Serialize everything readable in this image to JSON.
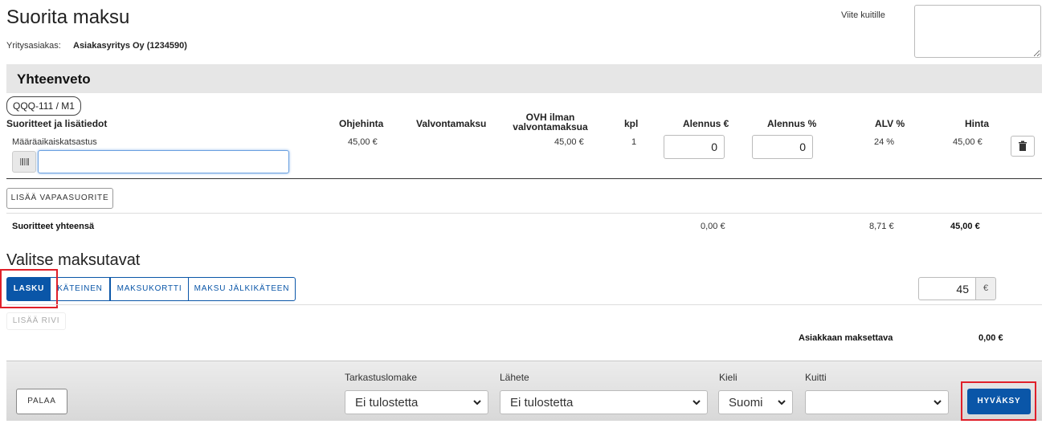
{
  "page": {
    "title": "Suorita maksu",
    "customer_label": "Yritysasiakas:",
    "customer_value": "Asiakasyritys Oy (1234590)",
    "reference_label": "Viite kuitille",
    "reference_value": ""
  },
  "summary": {
    "heading": "Yhteenveto",
    "vehicle_tag": "QQQ-111 / M1",
    "columns": {
      "service": "Suoritteet ja lisätiedot",
      "list_price": "Ohjehinta",
      "supervision_fee": "Valvontamaksu",
      "ovh_line1": "OVH ilman",
      "ovh_line2": "valvontamaksua",
      "qty": "kpl",
      "discount_eur": "Alennus €",
      "discount_pct": "Alennus %",
      "vat_pct": "ALV %",
      "price": "Hinta"
    },
    "row": {
      "service": "Määräaikaiskatsastus",
      "list_price": "45,00 €",
      "supervision_fee": "",
      "ovh": "45,00 €",
      "qty": "1",
      "discount_eur": "0",
      "discount_pct": "0",
      "vat_pct": "24 %",
      "price": "45,00 €",
      "barcode_value": ""
    },
    "add_free_service": "LISÄÄ VAPAASUORITE",
    "totals": {
      "label": "Suoritteet yhteensä",
      "discount": "0,00 €",
      "vat": "8,71 €",
      "price": "45,00 €"
    }
  },
  "payment": {
    "heading": "Valitse maksutavat",
    "methods": [
      "LASKU",
      "KÄTEINEN",
      "MAKSUKORTTI",
      "MAKSU JÄLKIKÄTEEN"
    ],
    "selected": "LASKU",
    "amount": "45",
    "currency": "€",
    "add_row": "LISÄÄ RIVI",
    "customer_payable_label": "Asiakkaan maksettava",
    "customer_payable_value": "0,00 €"
  },
  "footer": {
    "back": "PALAA",
    "inspection_form_label": "Tarkastuslomake",
    "inspection_form_value": "Ei tulostetta",
    "dispatch_label": "Lähete",
    "dispatch_value": "Ei tulostetta",
    "language_label": "Kieli",
    "language_value": "Suomi",
    "receipt_label": "Kuitti",
    "receipt_value": "",
    "approve": "HYVÄKSY"
  },
  "colors": {
    "primary": "#0a56a8",
    "highlight": "#e0202a",
    "summary_bg": "#e6e6e6"
  },
  "icons": [
    "barcode-icon",
    "trash-icon",
    "chevron-down-icon"
  ]
}
